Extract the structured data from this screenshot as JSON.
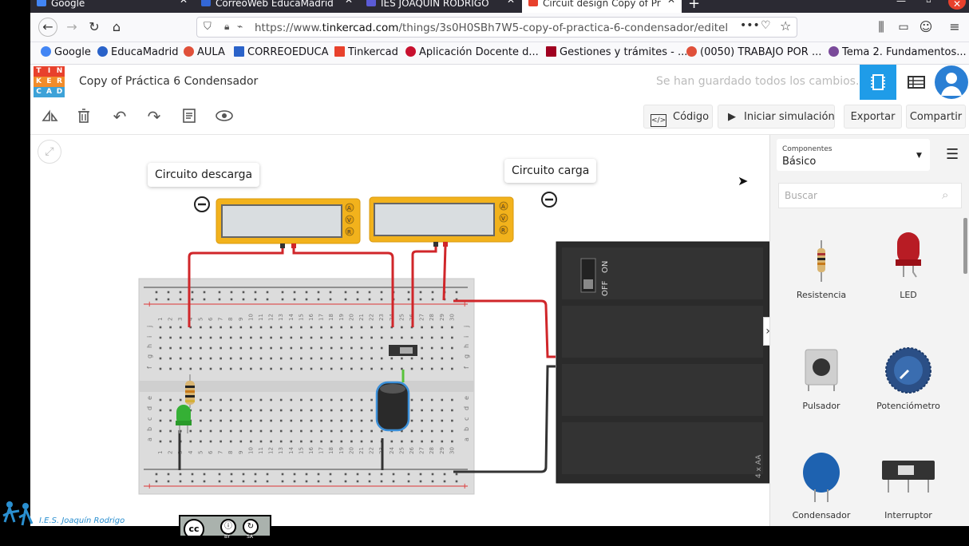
{
  "browser": {
    "tabs": [
      {
        "label": "Google",
        "color": "#4285f4"
      },
      {
        "label": "CorreoWeb EducaMadrid",
        "color": "#3367d6"
      },
      {
        "label": "IES JOAQUIN RODRIGO",
        "color": "#5b5bd6"
      },
      {
        "label": "Circuit design Copy of Pr",
        "color": "#e8412c"
      }
    ],
    "url_prefix": "https://www.",
    "url_domain": "tinkercad.com",
    "url_path": "/things/3s0H0SBh7W5-copy-of-practica-6-condensador/editel",
    "bookmarks": [
      {
        "label": "Google",
        "color": "#4285f4"
      },
      {
        "label": "EducaMadrid",
        "color": "#2a62c9"
      },
      {
        "label": "AULA",
        "color": "#e0503a"
      },
      {
        "label": "CORREOEDUCA",
        "color": "#2a62c9"
      },
      {
        "label": "Tinkercad",
        "color": "#e8412c"
      },
      {
        "label": "Aplicación Docente d...",
        "color": "#c8102e"
      },
      {
        "label": "Gestiones y trámites - ...",
        "color": "#a00020"
      },
      {
        "label": "(0050) TRABAJO POR ...",
        "color": "#e0503a"
      },
      {
        "label": "Tema 2. Fundamentos...",
        "color": "#7a4a9a"
      }
    ]
  },
  "app": {
    "logo_letters": [
      "T",
      "I",
      "N",
      "K",
      "E",
      "R",
      "C",
      "A",
      "D"
    ],
    "logo_colors": [
      "#e8412c",
      "#e8412c",
      "#e8412c",
      "#f28c2a",
      "#f28c2a",
      "#f28c2a",
      "#3da2d8",
      "#3da2d8",
      "#3da2d8"
    ],
    "title": "Copy of Práctica 6 Condensador",
    "saved_status": "Se han guardado todos los cambios."
  },
  "toolbar": {
    "code_label": "Código",
    "simulate_label": "Iniciar simulación",
    "export_label": "Exportar",
    "share_label": "Compartir"
  },
  "workspace": {
    "callout_discharge": "Circuito descarga",
    "callout_charge": "Circuito carga",
    "battery_label": "4 x AA",
    "switch_off": "OFF",
    "switch_on": "ON",
    "breadboard_columns": [
      "1",
      "2",
      "3",
      "4",
      "5",
      "6",
      "7",
      "8",
      "9",
      "10",
      "11",
      "12",
      "13",
      "14",
      "15",
      "16",
      "17",
      "18",
      "19",
      "20",
      "21",
      "22",
      "23",
      "24",
      "25",
      "26",
      "27",
      "28",
      "29",
      "30"
    ],
    "rows_top": [
      "j",
      "i",
      "h",
      "g",
      "f"
    ],
    "rows_bottom": [
      "e",
      "d",
      "c",
      "b",
      "a"
    ]
  },
  "panel": {
    "components_caption": "Componentes",
    "components_value": "Básico",
    "search_placeholder": "Buscar",
    "items": [
      {
        "label": "Resistencia",
        "icon": "resistor-icon"
      },
      {
        "label": "LED",
        "icon": "led-icon"
      },
      {
        "label": "Pulsador",
        "icon": "pushbutton-icon"
      },
      {
        "label": "Potenciómetro",
        "icon": "potentiometer-icon"
      },
      {
        "label": "Condensador",
        "icon": "capacitor-icon"
      },
      {
        "label": "Interruptor",
        "icon": "slide-switch-icon"
      }
    ]
  },
  "footer": {
    "school": "I.E.S. Joaquín Rodrigo",
    "license_by": "BY",
    "license_sa": "SA"
  }
}
